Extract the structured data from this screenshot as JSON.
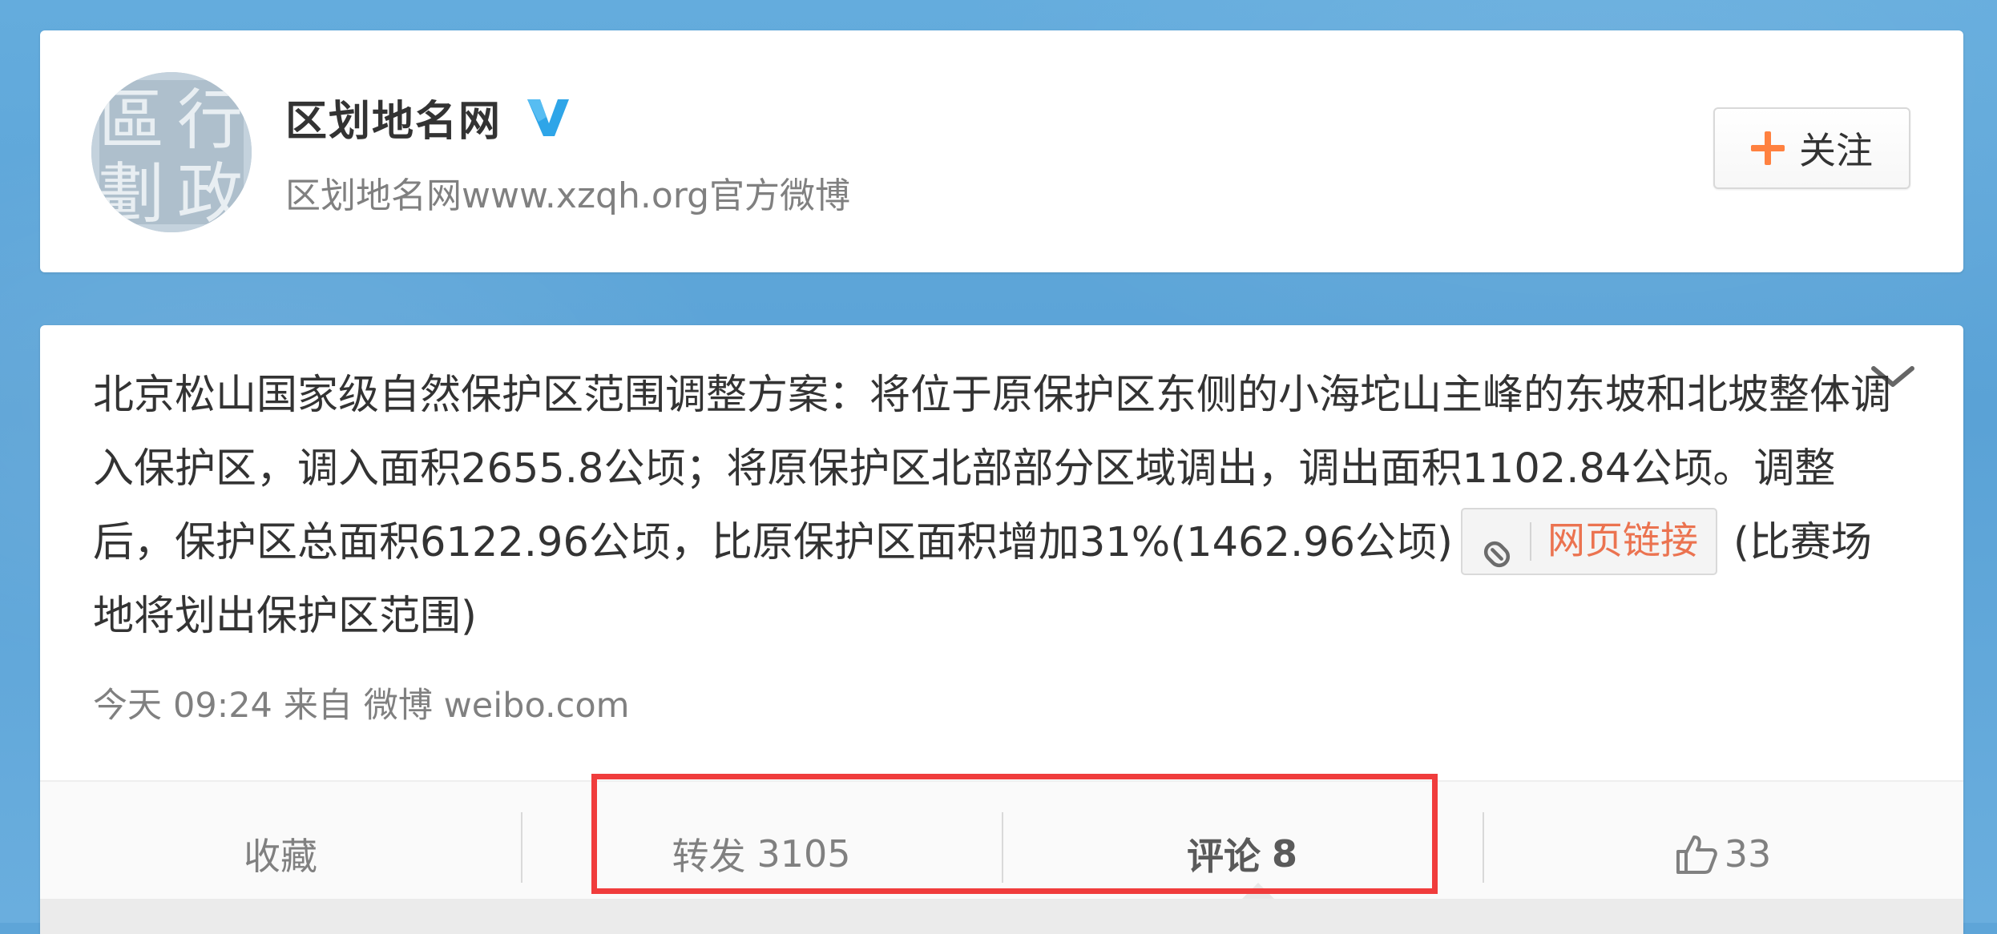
{
  "profile": {
    "name": "区划地名网",
    "description": "区划地名网www.xzqh.org官方微博",
    "avatar_glyphs": [
      "區",
      "行",
      "劃",
      "政"
    ],
    "verified_icon": "verified-v-icon",
    "follow_label": "关注"
  },
  "post": {
    "text_before_link": "北京松山国家级自然保护区范围调整方案：将位于原保护区东侧的小海坨山主峰的东坡和北坡整体调入保护区，调入面积2655.8公顷；将原保护区北部部分区域调出，调出面积1102.84公顷。调整后，保护区总面积6122.96公顷，比原保护区面积增加31%(1462.96公顷)",
    "link_label": "网页链接",
    "text_after_link": "(比赛场地将划出保护区范围)",
    "meta": {
      "date": "今天",
      "time": "09:24",
      "from_label": "来自",
      "source": "微博 weibo.com"
    }
  },
  "actions": {
    "favorite_label": "收藏",
    "repost_label": "转发",
    "repost_count": "3105",
    "comment_label": "评论",
    "comment_count": "8",
    "like_count": "33"
  },
  "colors": {
    "accent_orange": "#ff8140",
    "link_orange": "#eb7350",
    "verified_blue": "#2ea5e8",
    "highlight_red": "#f03c3c",
    "page_blue": "#5ea5d8"
  }
}
